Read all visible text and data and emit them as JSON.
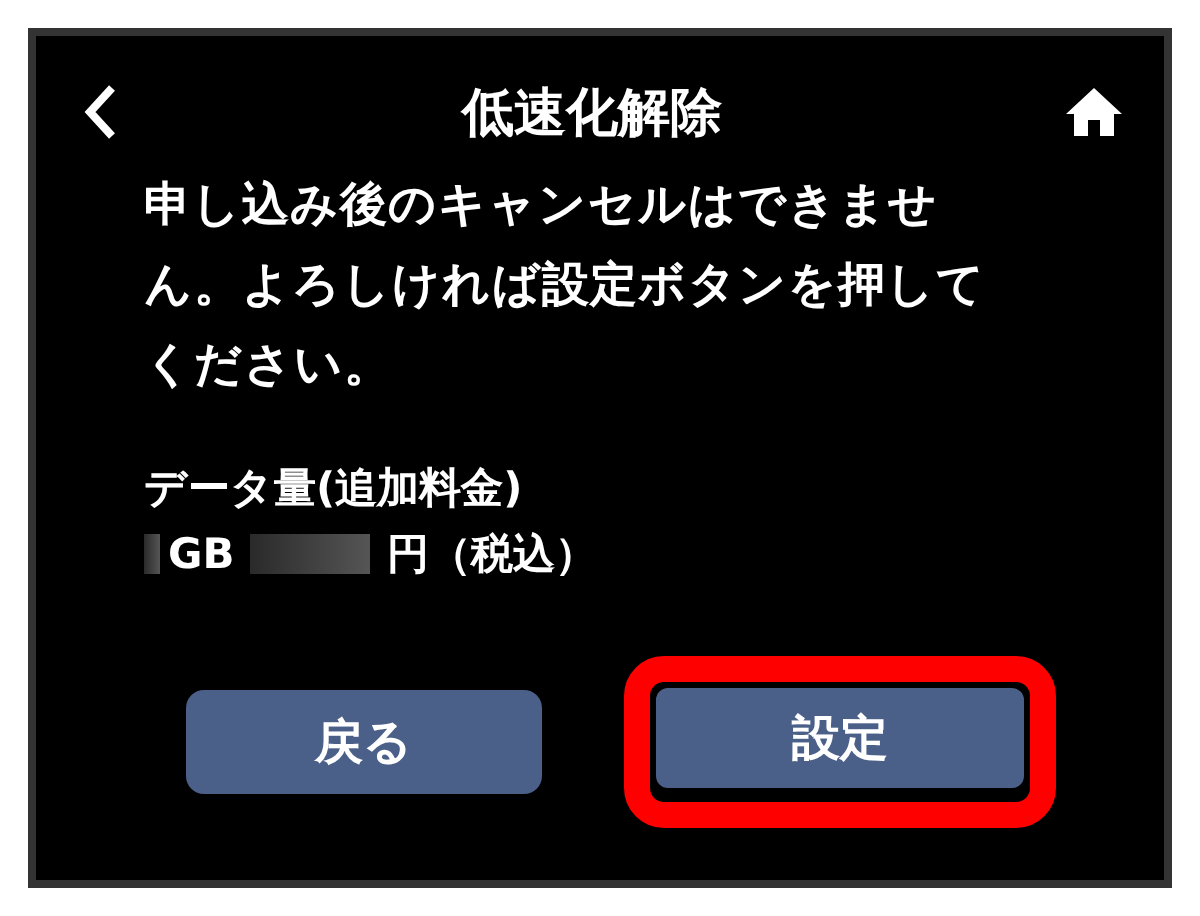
{
  "header": {
    "title": "低速化解除"
  },
  "message": "申し込み後のキャンセルはできません。よろしければ設定ボタンを押してください。",
  "data_label": "データ量(追加料金)",
  "data_value": [
    {
      "kind": "mask-short"
    },
    {
      "kind": "text",
      "text": "GB"
    },
    {
      "kind": "mask-long"
    },
    {
      "kind": "text",
      "text": "円（税込）"
    }
  ],
  "buttons": [
    {
      "label": "戻る",
      "highlighted": false
    },
    {
      "label": "設定",
      "highlighted": true
    }
  ]
}
